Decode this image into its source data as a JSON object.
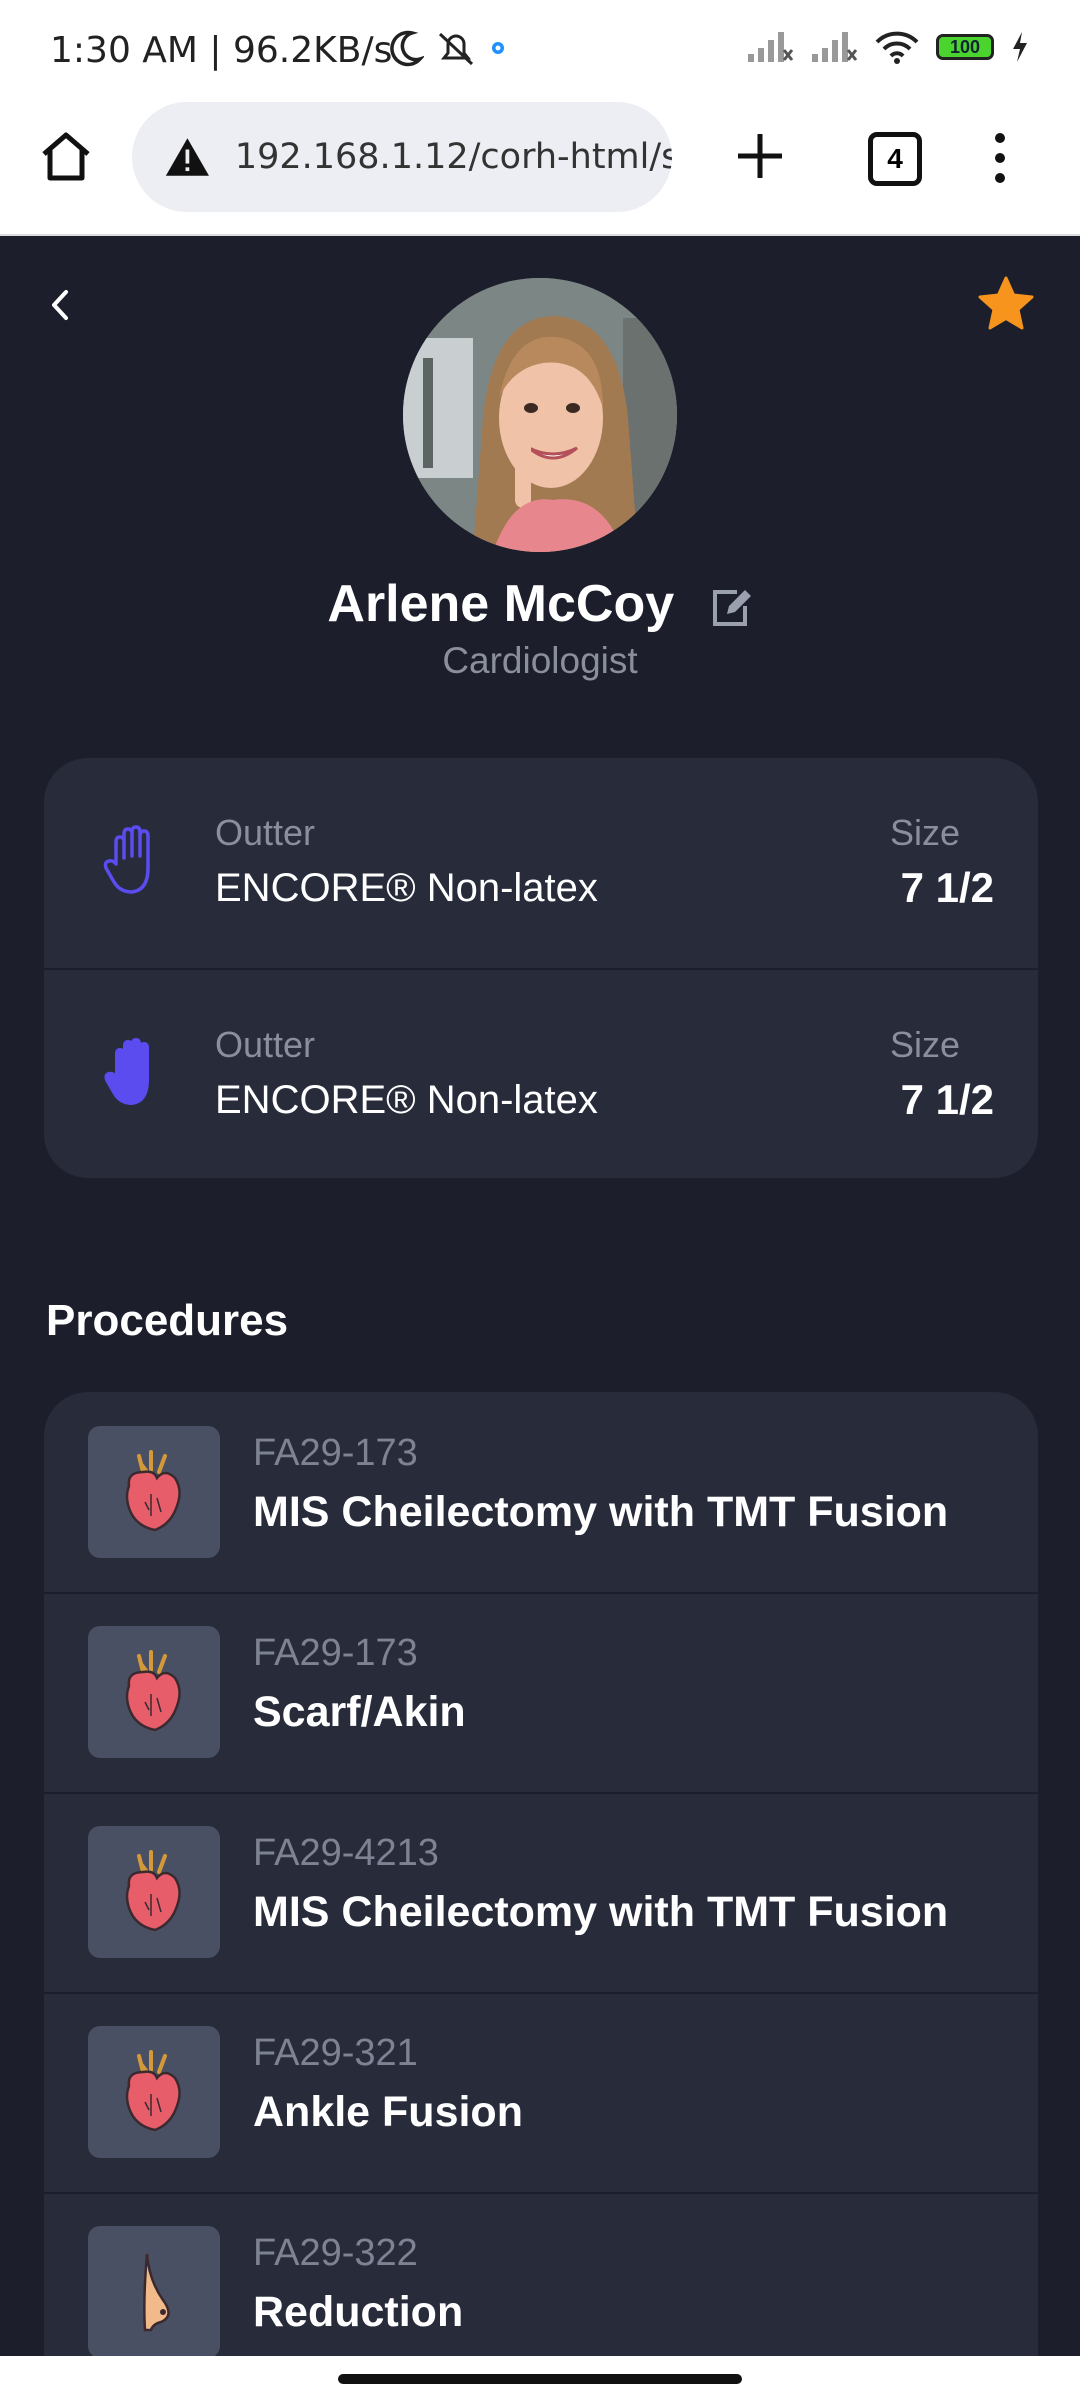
{
  "status": {
    "time": "1:30 AM | 96.2KB/s",
    "battery": "100"
  },
  "browser": {
    "url": "192.168.1.12/corh-html/su",
    "tab_count": "4"
  },
  "profile": {
    "name": "Arlene McCoy",
    "role": "Cardiologist"
  },
  "gloves": [
    {
      "label": "Outter",
      "name": "ENCORE® Non-latex",
      "size_label": "Size",
      "size": "7 1/2",
      "icon": "hand-outline-icon"
    },
    {
      "label": "Outter",
      "name": "ENCORE® Non-latex",
      "size_label": "Size",
      "size": "7 1/2",
      "icon": "hand-filled-icon"
    }
  ],
  "procedures_title": "Procedures",
  "procedures": [
    {
      "code": "FA29-173",
      "title": "MIS Cheilectomy with TMT Fusion",
      "icon": "heart-icon"
    },
    {
      "code": "FA29-173",
      "title": "Scarf/Akin",
      "icon": "heart-icon"
    },
    {
      "code": "FA29-4213",
      "title": "MIS Cheilectomy with TMT Fusion",
      "icon": "heart-icon"
    },
    {
      "code": "FA29-321",
      "title": "Ankle Fusion",
      "icon": "heart-icon"
    },
    {
      "code": "FA29-322",
      "title": "Reduction",
      "icon": "breast-icon"
    }
  ],
  "colors": {
    "background": "#1c1f2b",
    "card": "#272b3a",
    "accent_star": "#f7941d",
    "glove_icon": "#5b4cf0"
  }
}
